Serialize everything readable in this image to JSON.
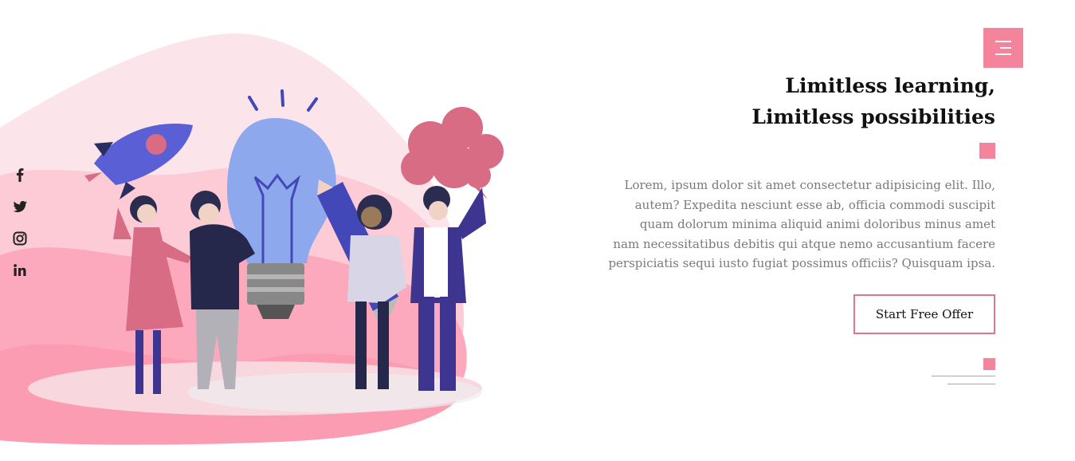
{
  "social": [
    {
      "name": "facebook",
      "icon": "facebook-icon"
    },
    {
      "name": "twitter",
      "icon": "twitter-icon"
    },
    {
      "name": "instagram",
      "icon": "instagram-icon"
    },
    {
      "name": "linkedin",
      "icon": "linkedin-icon"
    }
  ],
  "header": {
    "menu_icon": "menu-icon"
  },
  "hero": {
    "title_line1": "Limitless learning,",
    "title_line2": "Limitless possibilities",
    "text_lines": [
      "Lorem, ipsum dolor sit amet consectetur adipisicing elit. Illo,",
      "autem? Expedita nesciunt esse ab, officia commodi suscipit",
      "quam dolorum minima aliquid animi doloribus minus amet",
      "nam necessitatibus debitis qui atque nemo accusantium facere",
      "perspiciatis sequi iusto fugiat possimus officiis? Quisquam ipsa."
    ],
    "cta_label": "Start Free Offer"
  },
  "colors": {
    "accent": "#f4849b",
    "title": "#111111",
    "body_text": "#7a7a7a",
    "button_border": "#d9778e"
  }
}
